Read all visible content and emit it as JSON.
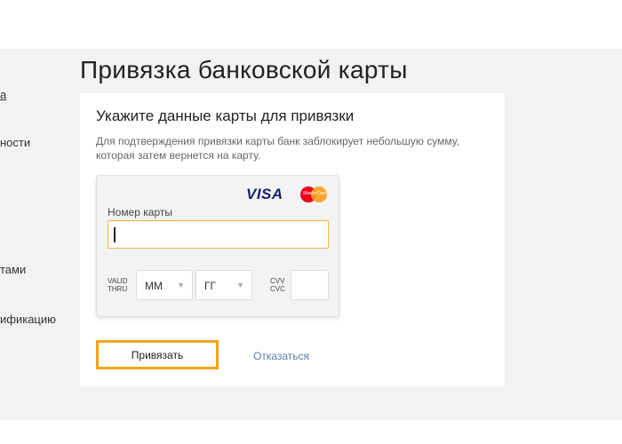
{
  "sidebar": {
    "items": [
      {
        "label": "a"
      },
      {
        "label": "ности"
      },
      {
        "label": "тами"
      },
      {
        "label": "ификацию"
      }
    ]
  },
  "page": {
    "title": "Привязка банковской карты"
  },
  "panel": {
    "heading": "Укажите данные карты для привязки",
    "description": "Для подтверждения привязки карты банк заблокирует небольшую сумму, которая затем вернется на карту."
  },
  "card_form": {
    "brand_visa": "VISA",
    "brand_mastercard": "MasterCard",
    "card_number_label": "Номер карты",
    "card_number_value": "",
    "valid_thru_label_line1": "VALID",
    "valid_thru_label_line2": "THRU",
    "month_value": "ММ",
    "year_value": "ГГ",
    "cvv_label_line1": "CVV",
    "cvv_label_line2": "CVC",
    "cvv_value": ""
  },
  "actions": {
    "bind_label": "Привязать",
    "cancel_label": "Отказаться"
  },
  "colors": {
    "accent": "#f4a31a",
    "link": "#5b7da8",
    "visa": "#1a1f71"
  }
}
